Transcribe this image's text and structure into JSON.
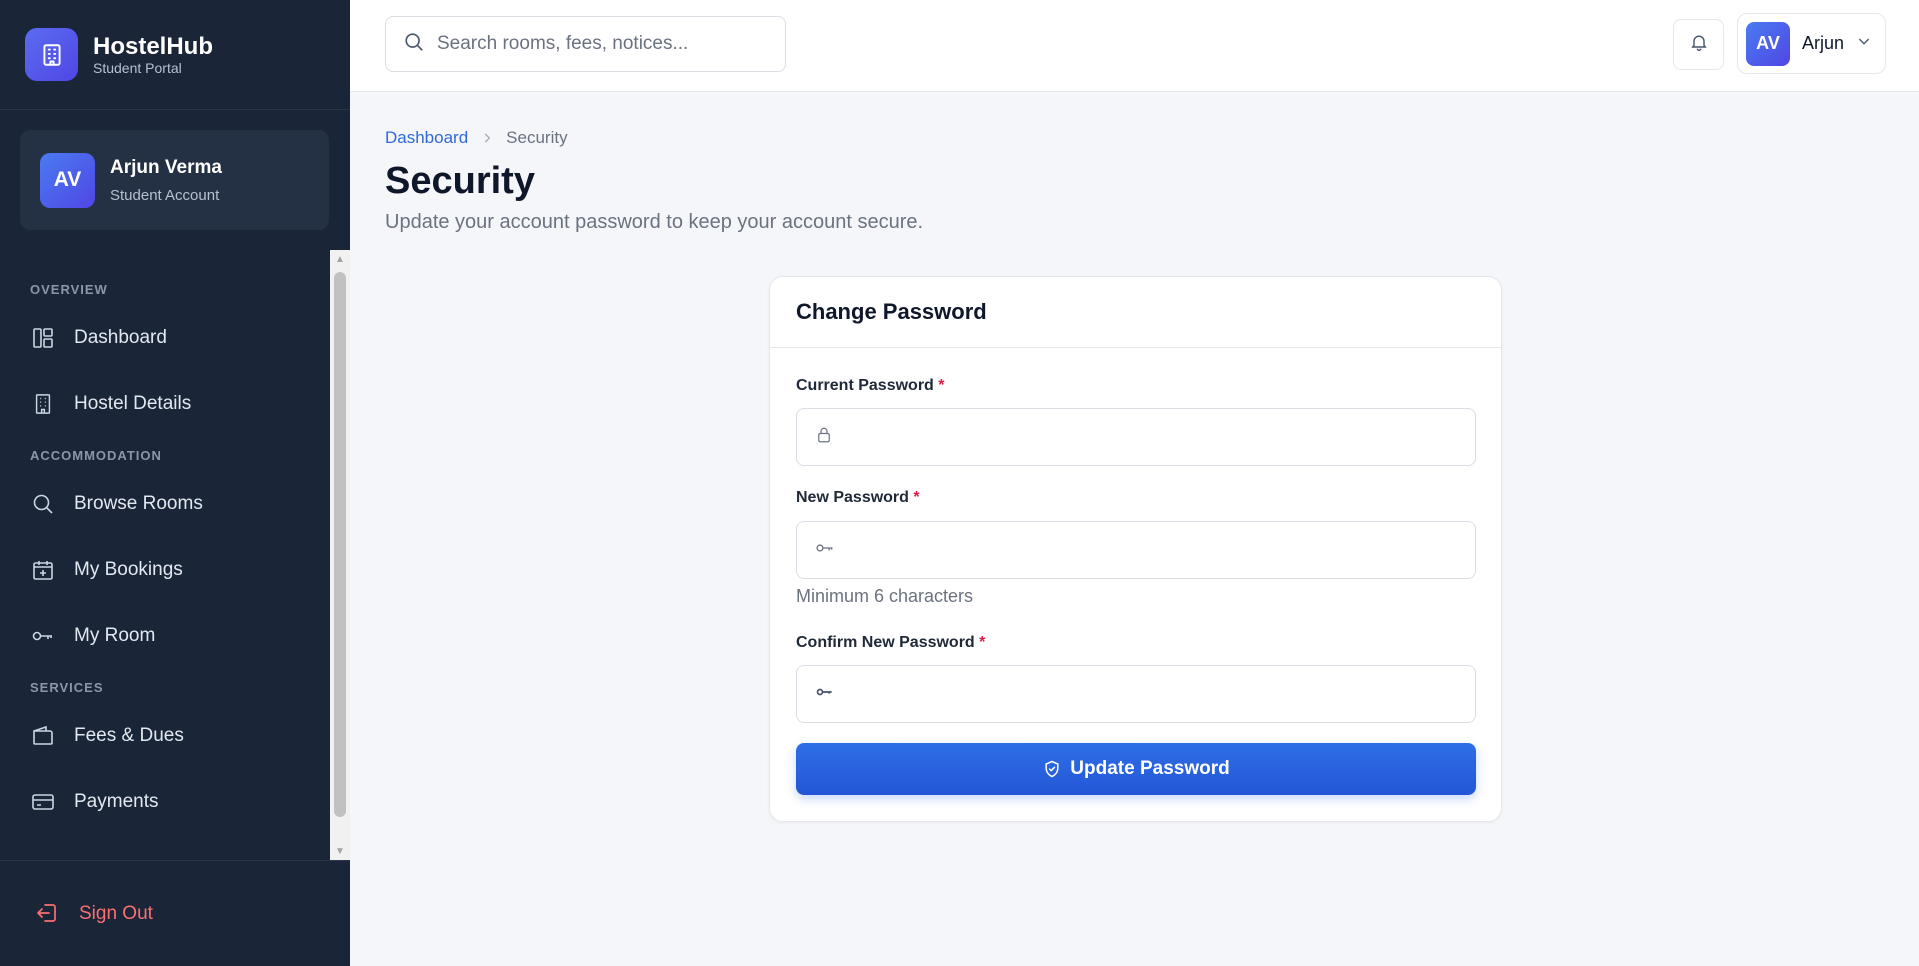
{
  "brand": {
    "name": "HostelHub",
    "subtitle": "Student Portal"
  },
  "user_card": {
    "initials": "AV",
    "name": "Arjun Verma",
    "role": "Student Account"
  },
  "sidebar": {
    "sections": [
      {
        "title": "OVERVIEW",
        "items": [
          {
            "label": "Dashboard",
            "icon": "dashboard-icon"
          },
          {
            "label": "Hostel Details",
            "icon": "building-icon"
          }
        ]
      },
      {
        "title": "ACCOMMODATION",
        "items": [
          {
            "label": "Browse Rooms",
            "icon": "search-icon"
          },
          {
            "label": "My Bookings",
            "icon": "calendar-plus-icon"
          },
          {
            "label": "My Room",
            "icon": "key-icon"
          }
        ]
      },
      {
        "title": "SERVICES",
        "items": [
          {
            "label": "Fees & Dues",
            "icon": "wallet-icon"
          },
          {
            "label": "Payments",
            "icon": "credit-card-icon"
          }
        ]
      }
    ],
    "signout_label": "Sign Out"
  },
  "topbar": {
    "search_placeholder": "Search rooms, fees, notices...",
    "profile_initials": "AV",
    "profile_name": "Arjun"
  },
  "breadcrumb": {
    "home": "Dashboard",
    "current": "Security"
  },
  "page": {
    "title": "Security",
    "subtitle": "Update your account password to keep your account secure."
  },
  "form": {
    "title": "Change Password",
    "current_label": "Current Password",
    "new_label": "New Password",
    "new_hint": "Minimum 6 characters",
    "confirm_label": "Confirm New Password",
    "required_mark": "*",
    "submit_label": "Update Password"
  },
  "colors": {
    "sidebar_bg": "#1b2538",
    "accent": "#2f6fe6",
    "danger": "#f87171"
  }
}
